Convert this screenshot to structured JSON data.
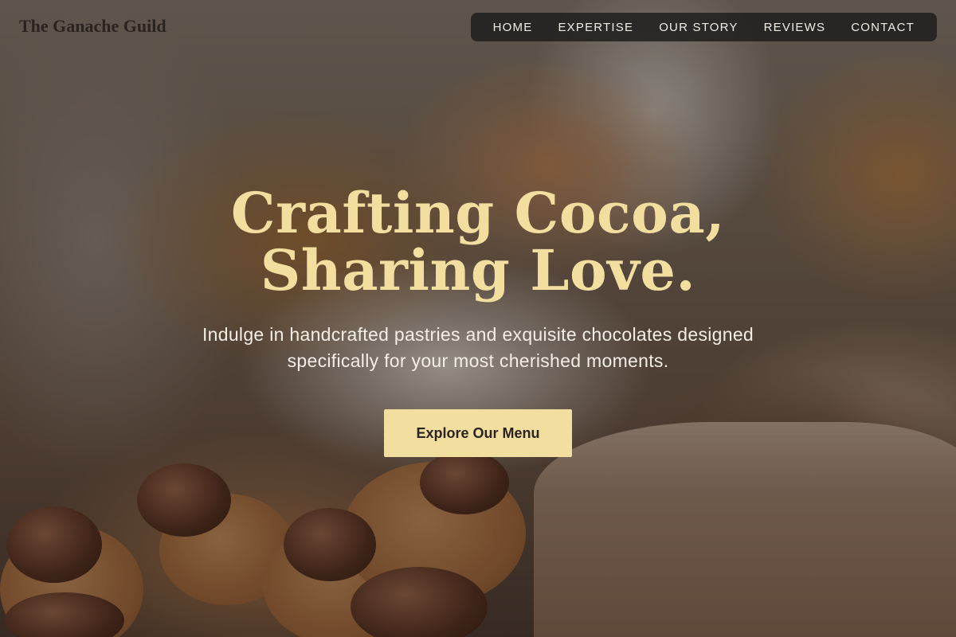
{
  "brand": {
    "name": "The Ganache Guild"
  },
  "nav": {
    "items": [
      "HOME",
      "EXPERTISE",
      "OUR STORY",
      "REVIEWS",
      "CONTACT"
    ]
  },
  "hero": {
    "headline": "Crafting Cocoa, Sharing Love.",
    "subtitle": "Indulge in handcrafted pastries and exquisite chocolates designed specifically for your most cherished moments.",
    "cta_label": "Explore Our Menu"
  },
  "colors": {
    "accent": "#f2dfa0",
    "nav_background": "#1e1e1e",
    "brand_text": "#2b2320"
  }
}
